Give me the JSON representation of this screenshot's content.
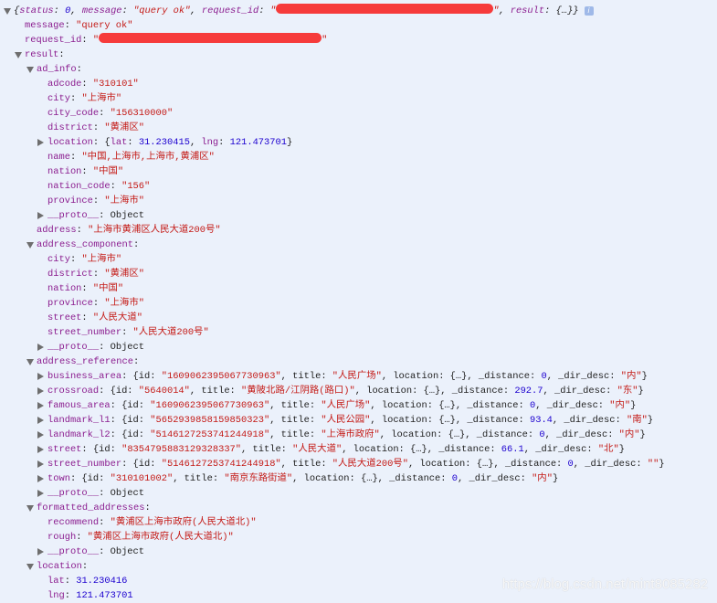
{
  "colors": {
    "background": "#ebf1fb",
    "key": "#8b1d8f",
    "string": "#c41a16",
    "number": "#1c00cf",
    "redaction": "#f63b3b"
  },
  "watermark": "https://blog.csdn.net/mint8085282",
  "rows": [
    {
      "d": 0,
      "tog": "open",
      "italic": true,
      "parts": [
        [
          "punct",
          "{"
        ],
        [
          "key",
          "status"
        ],
        [
          "punct",
          ": "
        ],
        [
          "num",
          "0"
        ],
        [
          "punct",
          ", "
        ],
        [
          "key",
          "message"
        ],
        [
          "punct",
          ": "
        ],
        [
          "str",
          "\"query ok\""
        ],
        [
          "punct",
          ", "
        ],
        [
          "key",
          "request_id"
        ],
        [
          "punct",
          ": "
        ],
        [
          "str",
          "\""
        ],
        [
          "redact",
          ""
        ],
        [
          "str",
          "\""
        ],
        [
          "punct",
          ", "
        ],
        [
          "key",
          "result"
        ],
        [
          "punct",
          ": {…}}"
        ],
        [
          "info",
          "i"
        ]
      ]
    },
    {
      "d": 1,
      "parts": [
        [
          "key",
          "message"
        ],
        [
          "punct",
          ": "
        ],
        [
          "str",
          "\"query ok\""
        ]
      ]
    },
    {
      "d": 1,
      "parts": [
        [
          "key",
          "request_id"
        ],
        [
          "punct",
          ": "
        ],
        [
          "str",
          "\""
        ],
        [
          "redact",
          ""
        ],
        [
          "str",
          "\""
        ]
      ]
    },
    {
      "d": 1,
      "tog": "open",
      "parts": [
        [
          "key",
          "result"
        ],
        [
          "punct",
          ":"
        ]
      ]
    },
    {
      "d": 2,
      "tog": "open",
      "parts": [
        [
          "key",
          "ad_info"
        ],
        [
          "punct",
          ":"
        ]
      ]
    },
    {
      "d": 3,
      "parts": [
        [
          "key",
          "adcode"
        ],
        [
          "punct",
          ": "
        ],
        [
          "str",
          "\"310101\""
        ]
      ]
    },
    {
      "d": 3,
      "parts": [
        [
          "key",
          "city"
        ],
        [
          "punct",
          ": "
        ],
        [
          "str",
          "\"上海市\""
        ]
      ]
    },
    {
      "d": 3,
      "parts": [
        [
          "key",
          "city_code"
        ],
        [
          "punct",
          ": "
        ],
        [
          "str",
          "\"156310000\""
        ]
      ]
    },
    {
      "d": 3,
      "parts": [
        [
          "key",
          "district"
        ],
        [
          "punct",
          ": "
        ],
        [
          "str",
          "\"黄浦区\""
        ]
      ]
    },
    {
      "d": 3,
      "tog": "closed",
      "parts": [
        [
          "key",
          "location"
        ],
        [
          "punct",
          ": {"
        ],
        [
          "key",
          "lat"
        ],
        [
          "punct",
          ": "
        ],
        [
          "num",
          "31.230415"
        ],
        [
          "punct",
          ", "
        ],
        [
          "key",
          "lng"
        ],
        [
          "punct",
          ": "
        ],
        [
          "num",
          "121.473701"
        ],
        [
          "punct",
          "}"
        ]
      ]
    },
    {
      "d": 3,
      "parts": [
        [
          "key",
          "name"
        ],
        [
          "punct",
          ": "
        ],
        [
          "str",
          "\"中国,上海市,上海市,黄浦区\""
        ]
      ]
    },
    {
      "d": 3,
      "parts": [
        [
          "key",
          "nation"
        ],
        [
          "punct",
          ": "
        ],
        [
          "str",
          "\"中国\""
        ]
      ]
    },
    {
      "d": 3,
      "parts": [
        [
          "key",
          "nation_code"
        ],
        [
          "punct",
          ": "
        ],
        [
          "str",
          "\"156\""
        ]
      ]
    },
    {
      "d": 3,
      "parts": [
        [
          "key",
          "province"
        ],
        [
          "punct",
          ": "
        ],
        [
          "str",
          "\"上海市\""
        ]
      ]
    },
    {
      "d": 3,
      "tog": "closed",
      "parts": [
        [
          "key",
          "__proto__"
        ],
        [
          "punct",
          ": Object"
        ]
      ]
    },
    {
      "d": 2,
      "parts": [
        [
          "key",
          "address"
        ],
        [
          "punct",
          ": "
        ],
        [
          "str",
          "\"上海市黄浦区人民大道200号\""
        ]
      ]
    },
    {
      "d": 2,
      "tog": "open",
      "parts": [
        [
          "key",
          "address_component"
        ],
        [
          "punct",
          ":"
        ]
      ]
    },
    {
      "d": 3,
      "parts": [
        [
          "key",
          "city"
        ],
        [
          "punct",
          ": "
        ],
        [
          "str",
          "\"上海市\""
        ]
      ]
    },
    {
      "d": 3,
      "parts": [
        [
          "key",
          "district"
        ],
        [
          "punct",
          ": "
        ],
        [
          "str",
          "\"黄浦区\""
        ]
      ]
    },
    {
      "d": 3,
      "parts": [
        [
          "key",
          "nation"
        ],
        [
          "punct",
          ": "
        ],
        [
          "str",
          "\"中国\""
        ]
      ]
    },
    {
      "d": 3,
      "parts": [
        [
          "key",
          "province"
        ],
        [
          "punct",
          ": "
        ],
        [
          "str",
          "\"上海市\""
        ]
      ]
    },
    {
      "d": 3,
      "parts": [
        [
          "key",
          "street"
        ],
        [
          "punct",
          ": "
        ],
        [
          "str",
          "\"人民大道\""
        ]
      ]
    },
    {
      "d": 3,
      "parts": [
        [
          "key",
          "street_number"
        ],
        [
          "punct",
          ": "
        ],
        [
          "str",
          "\"人民大道200号\""
        ]
      ]
    },
    {
      "d": 3,
      "tog": "closed",
      "parts": [
        [
          "key",
          "__proto__"
        ],
        [
          "punct",
          ": Object"
        ]
      ]
    },
    {
      "d": 2,
      "tog": "open",
      "parts": [
        [
          "key",
          "address_reference"
        ],
        [
          "punct",
          ":"
        ]
      ]
    },
    {
      "d": 3,
      "tog": "closed",
      "parts": [
        [
          "key",
          "business_area"
        ],
        [
          "punct",
          ": {id: "
        ],
        [
          "str",
          "\"1609062395067730963\""
        ],
        [
          "punct",
          ", title: "
        ],
        [
          "str",
          "\"人民广场\""
        ],
        [
          "punct",
          ", location: {…}, _distance: "
        ],
        [
          "num",
          "0"
        ],
        [
          "punct",
          ", _dir_desc: "
        ],
        [
          "str",
          "\"内\""
        ],
        [
          "punct",
          "}"
        ]
      ]
    },
    {
      "d": 3,
      "tog": "closed",
      "parts": [
        [
          "key",
          "crossroad"
        ],
        [
          "punct",
          ": {id: "
        ],
        [
          "str",
          "\"5640014\""
        ],
        [
          "punct",
          ", title: "
        ],
        [
          "str",
          "\"黄陂北路/江阴路(路口)\""
        ],
        [
          "punct",
          ", location: {…}, _distance: "
        ],
        [
          "num",
          "292.7"
        ],
        [
          "punct",
          ", _dir_desc: "
        ],
        [
          "str",
          "\"东\""
        ],
        [
          "punct",
          "}"
        ]
      ]
    },
    {
      "d": 3,
      "tog": "closed",
      "parts": [
        [
          "key",
          "famous_area"
        ],
        [
          "punct",
          ": {id: "
        ],
        [
          "str",
          "\"1609062395067730963\""
        ],
        [
          "punct",
          ", title: "
        ],
        [
          "str",
          "\"人民广场\""
        ],
        [
          "punct",
          ", location: {…}, _distance: "
        ],
        [
          "num",
          "0"
        ],
        [
          "punct",
          ", _dir_desc: "
        ],
        [
          "str",
          "\"内\""
        ],
        [
          "punct",
          "}"
        ]
      ]
    },
    {
      "d": 3,
      "tog": "closed",
      "parts": [
        [
          "key",
          "landmark_l1"
        ],
        [
          "punct",
          ": {id: "
        ],
        [
          "str",
          "\"5652939858159850323\""
        ],
        [
          "punct",
          ", title: "
        ],
        [
          "str",
          "\"人民公园\""
        ],
        [
          "punct",
          ", location: {…}, _distance: "
        ],
        [
          "num",
          "93.4"
        ],
        [
          "punct",
          ", _dir_desc: "
        ],
        [
          "str",
          "\"南\""
        ],
        [
          "punct",
          "}"
        ]
      ]
    },
    {
      "d": 3,
      "tog": "closed",
      "parts": [
        [
          "key",
          "landmark_l2"
        ],
        [
          "punct",
          ": {id: "
        ],
        [
          "str",
          "\"5146127253741244918\""
        ],
        [
          "punct",
          ", title: "
        ],
        [
          "str",
          "\"上海市政府\""
        ],
        [
          "punct",
          ", location: {…}, _distance: "
        ],
        [
          "num",
          "0"
        ],
        [
          "punct",
          ", _dir_desc: "
        ],
        [
          "str",
          "\"内\""
        ],
        [
          "punct",
          "}"
        ]
      ]
    },
    {
      "d": 3,
      "tog": "closed",
      "parts": [
        [
          "key",
          "street"
        ],
        [
          "punct",
          ": {id: "
        ],
        [
          "str",
          "\"8354795883129328337\""
        ],
        [
          "punct",
          ", title: "
        ],
        [
          "str",
          "\"人民大道\""
        ],
        [
          "punct",
          ", location: {…}, _distance: "
        ],
        [
          "num",
          "66.1"
        ],
        [
          "punct",
          ", _dir_desc: "
        ],
        [
          "str",
          "\"北\""
        ],
        [
          "punct",
          "}"
        ]
      ]
    },
    {
      "d": 3,
      "tog": "closed",
      "parts": [
        [
          "key",
          "street_number"
        ],
        [
          "punct",
          ": {id: "
        ],
        [
          "str",
          "\"5146127253741244918\""
        ],
        [
          "punct",
          ", title: "
        ],
        [
          "str",
          "\"人民大道200号\""
        ],
        [
          "punct",
          ", location: {…}, _distance: "
        ],
        [
          "num",
          "0"
        ],
        [
          "punct",
          ", _dir_desc: "
        ],
        [
          "str",
          "\"\""
        ],
        [
          "punct",
          "}"
        ]
      ]
    },
    {
      "d": 3,
      "tog": "closed",
      "parts": [
        [
          "key",
          "town"
        ],
        [
          "punct",
          ": {id: "
        ],
        [
          "str",
          "\"310101002\""
        ],
        [
          "punct",
          ", title: "
        ],
        [
          "str",
          "\"南京东路街道\""
        ],
        [
          "punct",
          ", location: {…}, _distance: "
        ],
        [
          "num",
          "0"
        ],
        [
          "punct",
          ", _dir_desc: "
        ],
        [
          "str",
          "\"内\""
        ],
        [
          "punct",
          "}"
        ]
      ]
    },
    {
      "d": 3,
      "tog": "closed",
      "parts": [
        [
          "key",
          "__proto__"
        ],
        [
          "punct",
          ": Object"
        ]
      ]
    },
    {
      "d": 2,
      "tog": "open",
      "parts": [
        [
          "key",
          "formatted_addresses"
        ],
        [
          "punct",
          ":"
        ]
      ]
    },
    {
      "d": 3,
      "parts": [
        [
          "key",
          "recommend"
        ],
        [
          "punct",
          ": "
        ],
        [
          "str",
          "\"黄浦区上海市政府(人民大道北)\""
        ]
      ]
    },
    {
      "d": 3,
      "parts": [
        [
          "key",
          "rough"
        ],
        [
          "punct",
          ": "
        ],
        [
          "str",
          "\"黄浦区上海市政府(人民大道北)\""
        ]
      ]
    },
    {
      "d": 3,
      "tog": "closed",
      "parts": [
        [
          "key",
          "__proto__"
        ],
        [
          "punct",
          ": Object"
        ]
      ]
    },
    {
      "d": 2,
      "tog": "open",
      "parts": [
        [
          "key",
          "location"
        ],
        [
          "punct",
          ":"
        ]
      ]
    },
    {
      "d": 3,
      "parts": [
        [
          "key",
          "lat"
        ],
        [
          "punct",
          ": "
        ],
        [
          "num",
          "31.230416"
        ]
      ]
    },
    {
      "d": 3,
      "parts": [
        [
          "key",
          "lng"
        ],
        [
          "punct",
          ": "
        ],
        [
          "num",
          "121.473701"
        ]
      ]
    }
  ]
}
